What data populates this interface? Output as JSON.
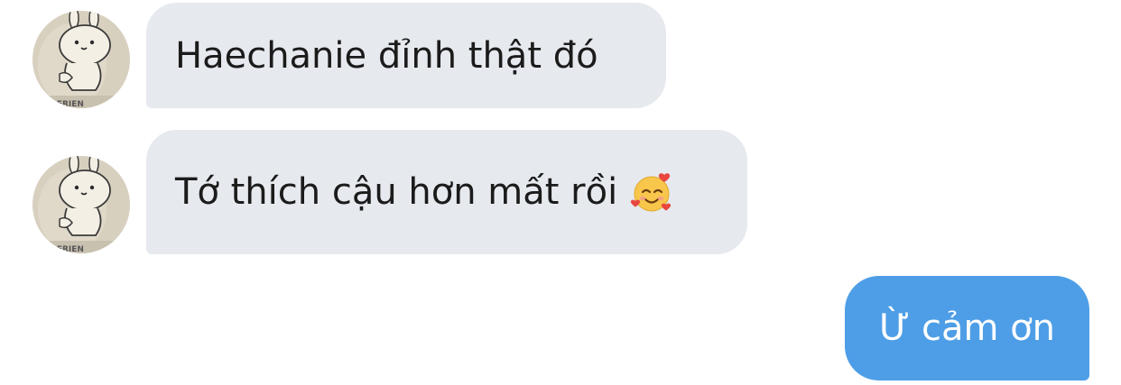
{
  "conversation": {
    "messages": [
      {
        "sender": "contact",
        "text": "Haechanie đỉnh thật đó"
      },
      {
        "sender": "contact",
        "text": "Tớ thích cậu hơn mất rồi",
        "emoji": "smiling-face-with-hearts-icon"
      },
      {
        "sender": "me",
        "text": "Ừ cảm ơn"
      }
    ]
  },
  "colors": {
    "incoming_bubble": "#e6e9ee",
    "outgoing_bubble": "#4e9ee7",
    "outgoing_text": "#ffffff",
    "incoming_text": "#1b1b1b"
  },
  "avatar": {
    "icon": "bunny-sticker-avatar-icon"
  }
}
